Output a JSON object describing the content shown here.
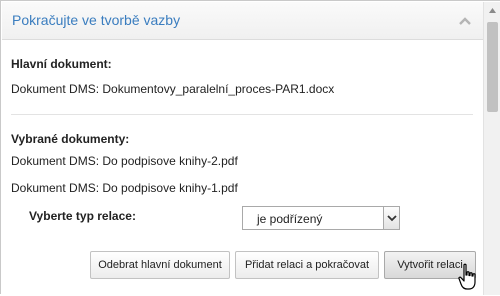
{
  "panel": {
    "title": "Pokračujte ve tvorbě vazby"
  },
  "main_document": {
    "label": "Hlavní dokument:",
    "value": "Dokument DMS: Dokumentovy_paralelní_proces-PAR1.docx"
  },
  "selected_documents": {
    "label": "Vybrané dokumenty:",
    "items": [
      "Dokument DMS: Do podpisove knihy-2.pdf",
      "Dokument DMS: Do podpisove knihy-1.pdf"
    ]
  },
  "relation_type": {
    "label": "Vyberte typ relace:",
    "selected": "je podřízený"
  },
  "buttons": {
    "remove_main": "Odebrat hlavní dokument",
    "add_and_continue": "Přidat relaci a pokračovat",
    "create": "Vytvořit relaci"
  },
  "colors": {
    "title": "#3a7dbf"
  },
  "icons": {
    "collapse": "chevron-up-icon",
    "scroll_up": "scroll-up-arrow-icon",
    "cursor": "hand-pointer-icon",
    "select": "dropdown-arrow-icon"
  }
}
